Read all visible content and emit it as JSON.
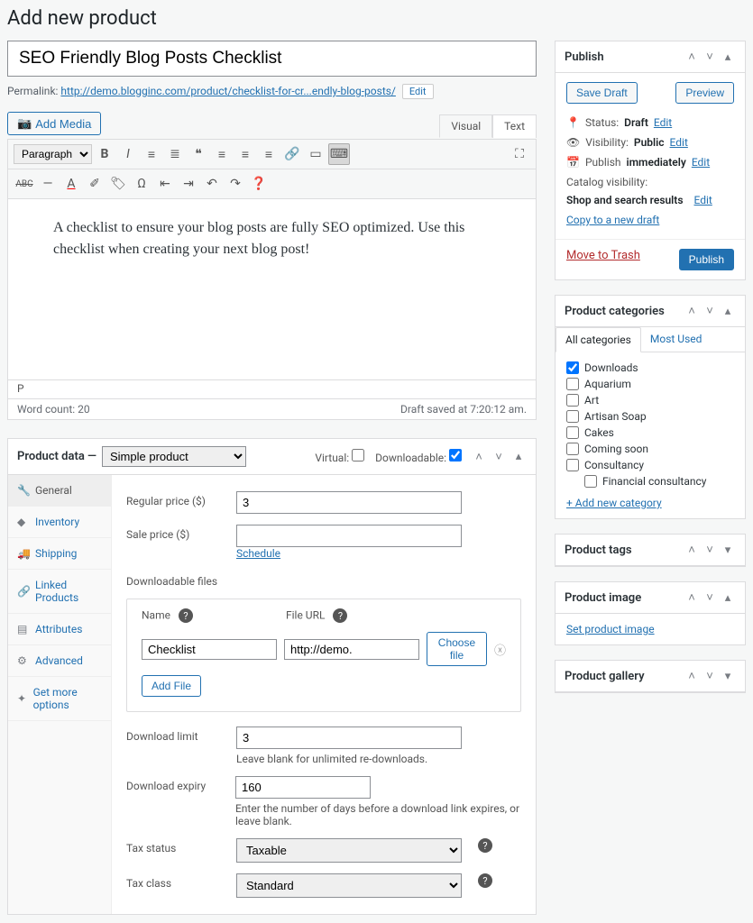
{
  "page_title": "Add new product",
  "product": {
    "title": "SEO Friendly Blog Posts Checklist",
    "permalink_label": "Permalink:",
    "permalink_base": "http://demo.blogginc.com/product/",
    "permalink_slug": "checklist-for-cr...endly-blog-posts/",
    "edit": "Edit"
  },
  "editor": {
    "add_media": "Add Media",
    "tab_visual": "Visual",
    "tab_text": "Text",
    "format_select": "Paragraph",
    "content": "A checklist to ensure your blog posts are fully SEO optimized. Use this checklist when creating your next blog post!",
    "status_tag": "P",
    "word_count_label": "Word count: 20",
    "save_status": "Draft saved at 7:20:12 am."
  },
  "product_data": {
    "header": "Product data —",
    "type": "Simple product",
    "virtual_label": "Virtual:",
    "downloadable_label": "Downloadable:",
    "tabs": {
      "general": "General",
      "inventory": "Inventory",
      "shipping": "Shipping",
      "linked": "Linked Products",
      "attributes": "Attributes",
      "advanced": "Advanced",
      "getmore": "Get more options"
    },
    "fields": {
      "regular_price_label": "Regular price ($)",
      "regular_price": "3",
      "sale_price_label": "Sale price ($)",
      "sale_price": "",
      "schedule": "Schedule",
      "downloadable_files": "Downloadable files",
      "dl_name_h": "Name",
      "dl_url_h": "File URL",
      "dl_name": "Checklist",
      "dl_url": "http://demo.",
      "choose_file": "Choose file",
      "add_file": "Add File",
      "download_limit_label": "Download limit",
      "download_limit": "3",
      "download_limit_help": "Leave blank for unlimited re-downloads.",
      "download_expiry_label": "Download expiry",
      "download_expiry": "160",
      "download_expiry_help": "Enter the number of days before a download link expires, or leave blank.",
      "tax_status_label": "Tax status",
      "tax_status": "Taxable",
      "tax_class_label": "Tax class",
      "tax_class": "Standard"
    }
  },
  "publish": {
    "title": "Publish",
    "save_draft": "Save Draft",
    "preview": "Preview",
    "status_label": "Status:",
    "status": "Draft",
    "visibility_label": "Visibility:",
    "visibility": "Public",
    "publish_label": "Publish",
    "immediately": "immediately",
    "catalog_label": "Catalog visibility:",
    "catalog": "Shop and search results",
    "edit": "Edit",
    "copy": "Copy to a new draft",
    "trash": "Move to Trash",
    "publish_btn": "Publish"
  },
  "categories": {
    "title": "Product categories",
    "tab_all": "All categories",
    "tab_most": "Most Used",
    "items": [
      {
        "label": "Downloads",
        "checked": true
      },
      {
        "label": "Aquarium",
        "checked": false
      },
      {
        "label": "Art",
        "checked": false
      },
      {
        "label": "Artisan Soap",
        "checked": false
      },
      {
        "label": "Cakes",
        "checked": false
      },
      {
        "label": "Coming soon",
        "checked": false
      },
      {
        "label": "Consultancy",
        "checked": false
      },
      {
        "label": "Financial consultancy",
        "checked": false,
        "sub": true
      }
    ],
    "add_new": "+ Add new category"
  },
  "tags": {
    "title": "Product tags"
  },
  "image": {
    "title": "Product image",
    "set": "Set product image"
  },
  "gallery": {
    "title": "Product gallery"
  }
}
